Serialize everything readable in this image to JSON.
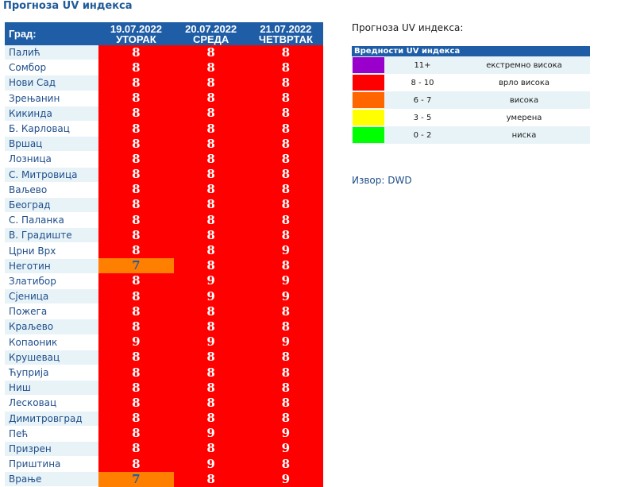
{
  "page_title": "Прогноза UV индекса",
  "colors": {
    "header_bg": "#1f5ea6",
    "level_8_10": "#ff0000",
    "level_6_7": "#ff7f00",
    "text_white": "#ffffff",
    "text_blue": "#1f5ea6"
  },
  "table": {
    "city_header": "Град:",
    "days": [
      {
        "date": "19.07.2022",
        "weekday": "УТОРАК"
      },
      {
        "date": "20.07.2022",
        "weekday": "СРЕДА"
      },
      {
        "date": "21.07.2022",
        "weekday": "ЧЕТВРТАК"
      }
    ],
    "rows": [
      {
        "city": "Палић",
        "values": [
          "8",
          "8",
          "8"
        ]
      },
      {
        "city": "Сомбор",
        "values": [
          "8",
          "8",
          "8"
        ]
      },
      {
        "city": "Нови Сад",
        "values": [
          "8",
          "8",
          "8"
        ]
      },
      {
        "city": "Зрењанин",
        "values": [
          "8",
          "8",
          "8"
        ]
      },
      {
        "city": "Кикинда",
        "values": [
          "8",
          "8",
          "8"
        ]
      },
      {
        "city": "Б. Карловац",
        "values": [
          "8",
          "8",
          "8"
        ]
      },
      {
        "city": "Вршац",
        "values": [
          "8",
          "8",
          "8"
        ]
      },
      {
        "city": "Лозница",
        "values": [
          "8",
          "8",
          "8"
        ]
      },
      {
        "city": "С. Митровица",
        "values": [
          "8",
          "8",
          "8"
        ]
      },
      {
        "city": "Ваљево",
        "values": [
          "8",
          "8",
          "8"
        ]
      },
      {
        "city": "Београд",
        "values": [
          "8",
          "8",
          "8"
        ]
      },
      {
        "city": "С. Паланка",
        "values": [
          "8",
          "8",
          "8"
        ]
      },
      {
        "city": "В. Градиште",
        "values": [
          "8",
          "8",
          "8"
        ]
      },
      {
        "city": "Црни Врх",
        "values": [
          "8",
          "8",
          "9"
        ]
      },
      {
        "city": "Неготин",
        "values": [
          "7",
          "8",
          "8"
        ]
      },
      {
        "city": "Златибор",
        "values": [
          "8",
          "9",
          "9"
        ]
      },
      {
        "city": "Сјеница",
        "values": [
          "8",
          "9",
          "9"
        ]
      },
      {
        "city": "Пожега",
        "values": [
          "8",
          "8",
          "8"
        ]
      },
      {
        "city": "Краљево",
        "values": [
          "8",
          "8",
          "8"
        ]
      },
      {
        "city": "Копаоник",
        "values": [
          "9",
          "9",
          "9"
        ]
      },
      {
        "city": "Крушевац",
        "values": [
          "8",
          "8",
          "8"
        ]
      },
      {
        "city": "Ћуприја",
        "values": [
          "8",
          "8",
          "8"
        ]
      },
      {
        "city": "Ниш",
        "values": [
          "8",
          "8",
          "8"
        ]
      },
      {
        "city": "Лесковац",
        "values": [
          "8",
          "8",
          "8"
        ]
      },
      {
        "city": "Димитровград",
        "values": [
          "8",
          "8",
          "8"
        ]
      },
      {
        "city": "Пећ",
        "values": [
          "8",
          "9",
          "9"
        ]
      },
      {
        "city": "Призрен",
        "values": [
          "8",
          "8",
          "9"
        ]
      },
      {
        "city": "Приштина",
        "values": [
          "8",
          "9",
          "8"
        ]
      },
      {
        "city": "Врање",
        "values": [
          "7",
          "8",
          "9"
        ]
      }
    ]
  },
  "legend": {
    "title": "Прогноза UV индекса:",
    "header": "Вредности UV индекса",
    "items": [
      {
        "range": "11+",
        "label": "екстремно висока",
        "color": "#9900cc"
      },
      {
        "range": "8 - 10",
        "label": "врло висока",
        "color": "#ff0000"
      },
      {
        "range": "6 - 7",
        "label": "висока",
        "color": "#ff6600"
      },
      {
        "range": "3 - 5",
        "label": "умерена",
        "color": "#ffff00"
      },
      {
        "range": "0 - 2",
        "label": "ниска",
        "color": "#00ff00"
      }
    ]
  },
  "source": {
    "label": "Извор:",
    "value": "DWD"
  }
}
